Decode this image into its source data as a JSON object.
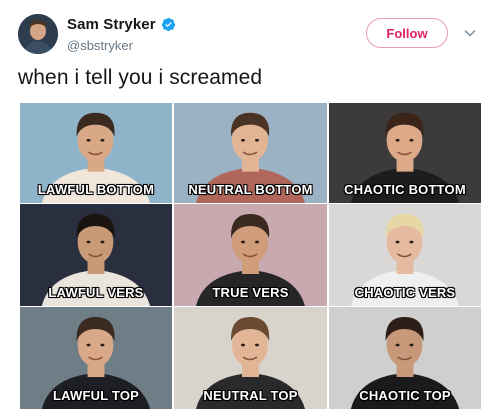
{
  "tweet": {
    "display_name": "Sam Stryker",
    "handle": "@sbstryker",
    "verified": true,
    "follow_label": "Follow",
    "text": "when i tell you i screamed",
    "icons": {
      "avatar": "avatar-photo",
      "verified": "verified-badge-icon",
      "menu": "chevron-down-icon"
    },
    "colors": {
      "follow": "#e0245e",
      "verified": "#1da1f2",
      "handle": "#657786"
    }
  },
  "meme": {
    "cells": [
      {
        "label": "LAWFUL BOTTOM",
        "bg": "#8fb3c9",
        "shirt": "#f0e6da",
        "hair": "#3b2a20",
        "skin": "#d9a987"
      },
      {
        "label": "NEUTRAL BOTTOM",
        "bg": "#9bb2c4",
        "shirt": "#b0675a",
        "hair": "#4a3224",
        "skin": "#e0b494"
      },
      {
        "label": "CHAOTIC BOTTOM",
        "bg": "#3d3a3c",
        "shirt": "#1d1d1f",
        "hair": "#3a2518",
        "skin": "#dcaa88"
      },
      {
        "label": "LAWFUL VERS",
        "bg": "#2a2f3f",
        "shirt": "#e9e4dc",
        "hair": "#1a1410",
        "skin": "#c99a76"
      },
      {
        "label": "TRUE VERS",
        "bg": "#c8a9b0",
        "shirt": "#262629",
        "hair": "#3a2a20",
        "skin": "#cf9d7a"
      },
      {
        "label": "CHAOTIC VERS",
        "bg": "#d9d8d6",
        "shirt": "#efefef",
        "hair": "#e6d7a4",
        "skin": "#e4bba0"
      },
      {
        "label": "LAWFUL TOP",
        "bg": "#6f7d86",
        "shirt": "#1e1f23",
        "hair": "#3a2a1f",
        "skin": "#d8a888"
      },
      {
        "label": "NEUTRAL TOP",
        "bg": "#d8d4cc",
        "shirt": "#2a2a2c",
        "hair": "#6a4a30",
        "skin": "#e2b597"
      },
      {
        "label": "CHAOTIC TOP",
        "bg": "#cfcfcf",
        "shirt": "#1b1b1d",
        "hair": "#2b1f18",
        "skin": "#c8987a"
      }
    ]
  }
}
